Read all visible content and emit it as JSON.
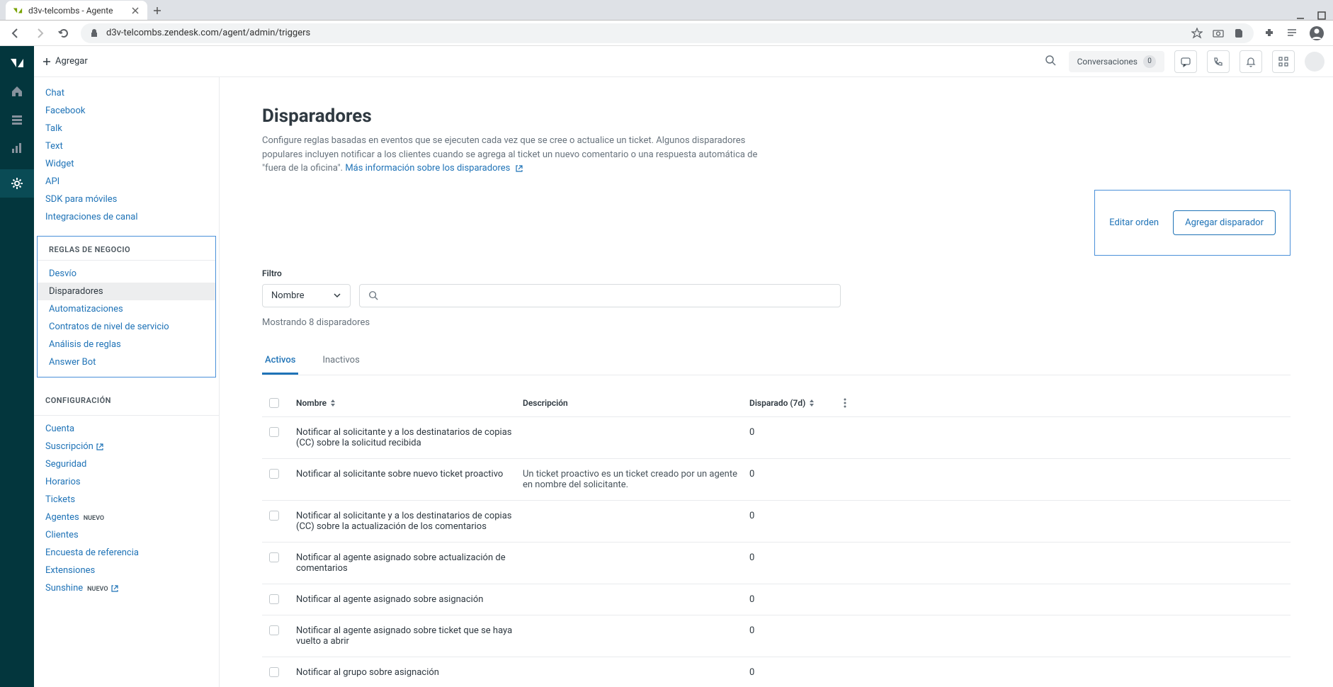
{
  "browser": {
    "tab_title": "d3v-telcombs - Agente",
    "url": "d3v-telcombs.zendesk.com/agent/admin/triggers"
  },
  "topbar": {
    "add_label": "Agregar",
    "conversations_label": "Conversaciones",
    "conversations_count": "0"
  },
  "sidebar": {
    "channels": [
      "Chat",
      "Facebook",
      "Talk",
      "Text",
      "Widget",
      "API",
      "SDK para móviles",
      "Integraciones de canal"
    ],
    "business_rules_header": "REGLAS DE NEGOCIO",
    "business_rules": [
      "Desvío",
      "Disparadores",
      "Automatizaciones",
      "Contratos de nivel de servicio",
      "Análisis de reglas",
      "Answer Bot"
    ],
    "config_header": "CONFIGURACIÓN",
    "config": [
      "Cuenta",
      "Suscripción",
      "Seguridad",
      "Horarios",
      "Tickets",
      "Agentes",
      "Clientes",
      "Encuesta de referencia",
      "Extensiones",
      "Sunshine"
    ],
    "new_badge": "NUEVO"
  },
  "page": {
    "title": "Disparadores",
    "description": "Configure reglas basadas en eventos que se ejecuten cada vez que se cree o actualice un ticket. Algunos disparadores populares incluyen notificar a los clientes cuando se agrega al ticket un nuevo comentario o una respuesta automática de \"fuera de la oficina\". ",
    "more_info_label": "Más información sobre los disparadores",
    "edit_order_label": "Editar orden",
    "add_trigger_label": "Agregar disparador",
    "filter_label": "Filtro",
    "filter_select_value": "Nombre",
    "result_count": "Mostrando 8 disparadores",
    "tabs": {
      "active": "Activos",
      "inactive": "Inactivos"
    }
  },
  "table": {
    "headers": {
      "name": "Nombre",
      "description": "Descripción",
      "fired": "Disparado (7d)"
    },
    "rows": [
      {
        "name": "Notificar al solicitante y a los destinatarios de copias (CC) sobre la solicitud recibida",
        "description": "",
        "fired": "0"
      },
      {
        "name": "Notificar al solicitante sobre nuevo ticket proactivo",
        "description": "Un ticket proactivo es un ticket creado por un agente en nombre del solicitante.",
        "fired": "0"
      },
      {
        "name": "Notificar al solicitante y a los destinatarios de copias (CC) sobre la actualización de los comentarios",
        "description": "",
        "fired": "0"
      },
      {
        "name": "Notificar al agente asignado sobre actualización de comentarios",
        "description": "",
        "fired": "0"
      },
      {
        "name": "Notificar al agente asignado sobre asignación",
        "description": "",
        "fired": "0"
      },
      {
        "name": "Notificar al agente asignado sobre ticket que se haya vuelto a abrir",
        "description": "",
        "fired": "0"
      },
      {
        "name": "Notificar al grupo sobre asignación",
        "description": "",
        "fired": "0"
      }
    ]
  }
}
